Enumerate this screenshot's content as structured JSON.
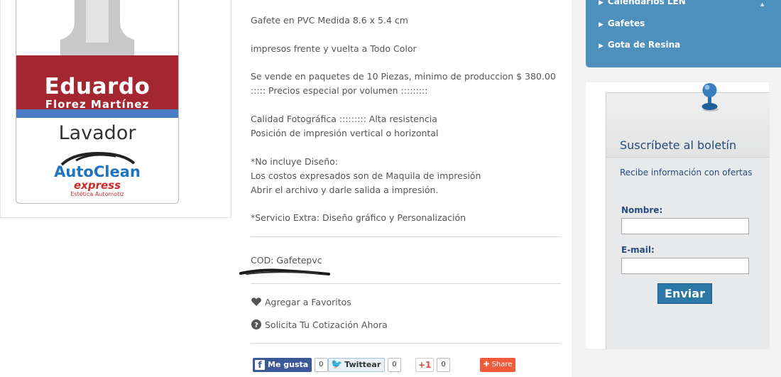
{
  "product_image": {
    "name_line1": "Eduardo",
    "name_line2": "Florez Martínez",
    "role": "Lavador",
    "logo_line1": "AutoClean",
    "logo_line2": "express",
    "logo_line3": "Estética Automotiz"
  },
  "description": {
    "lines": [
      "Gafete en PVC Medida 8.6 x 5.4 cm",
      "impresos frente y vuelta a Todo Color",
      "Se vende en paquetes de 10 Piezas, minimo de produccion $ 380.00",
      "::::: Precios especial por volumen :::::::::",
      "Calidad Fotográfica ::::::::: Alta resistencia",
      "Posición de impresión vertical o horizontal",
      "*No incluye Diseño:",
      "Los costos expresados son de Maquila de impresión",
      "Abrir el archivo y darle salida a impresión.",
      "*Servicio Extra: Diseño gráfico y Personalización"
    ],
    "cod": "COD: Gafetepvc"
  },
  "actions": {
    "favorites": "Agregar a Favoritos",
    "quote": "Solicita Tu Cotización Ahora"
  },
  "social": {
    "facebook_label": "Me gusta",
    "facebook_count": "0",
    "twitter_label": "Twittear",
    "twitter_count": "0",
    "gplus_label": "+1",
    "gplus_count": "0",
    "share_label": "Share"
  },
  "sidebar_menu": {
    "items": [
      {
        "label": "Calendarios LEN"
      },
      {
        "label": "Gafetes"
      },
      {
        "label": "Gota de Resina"
      }
    ]
  },
  "newsletter": {
    "title": "Suscríbete al boletín",
    "subtitle": "Recibe información con ofertas",
    "name_label": "Nombre:",
    "email_label": "E-mail:",
    "name_value": "",
    "email_value": "",
    "submit_label": "Enviar"
  },
  "colors": {
    "menu_bg": "#4d8fbd",
    "badge_red": "#a32630",
    "button_blue": "#2b77a8",
    "newsletter_text": "#274b7c"
  }
}
